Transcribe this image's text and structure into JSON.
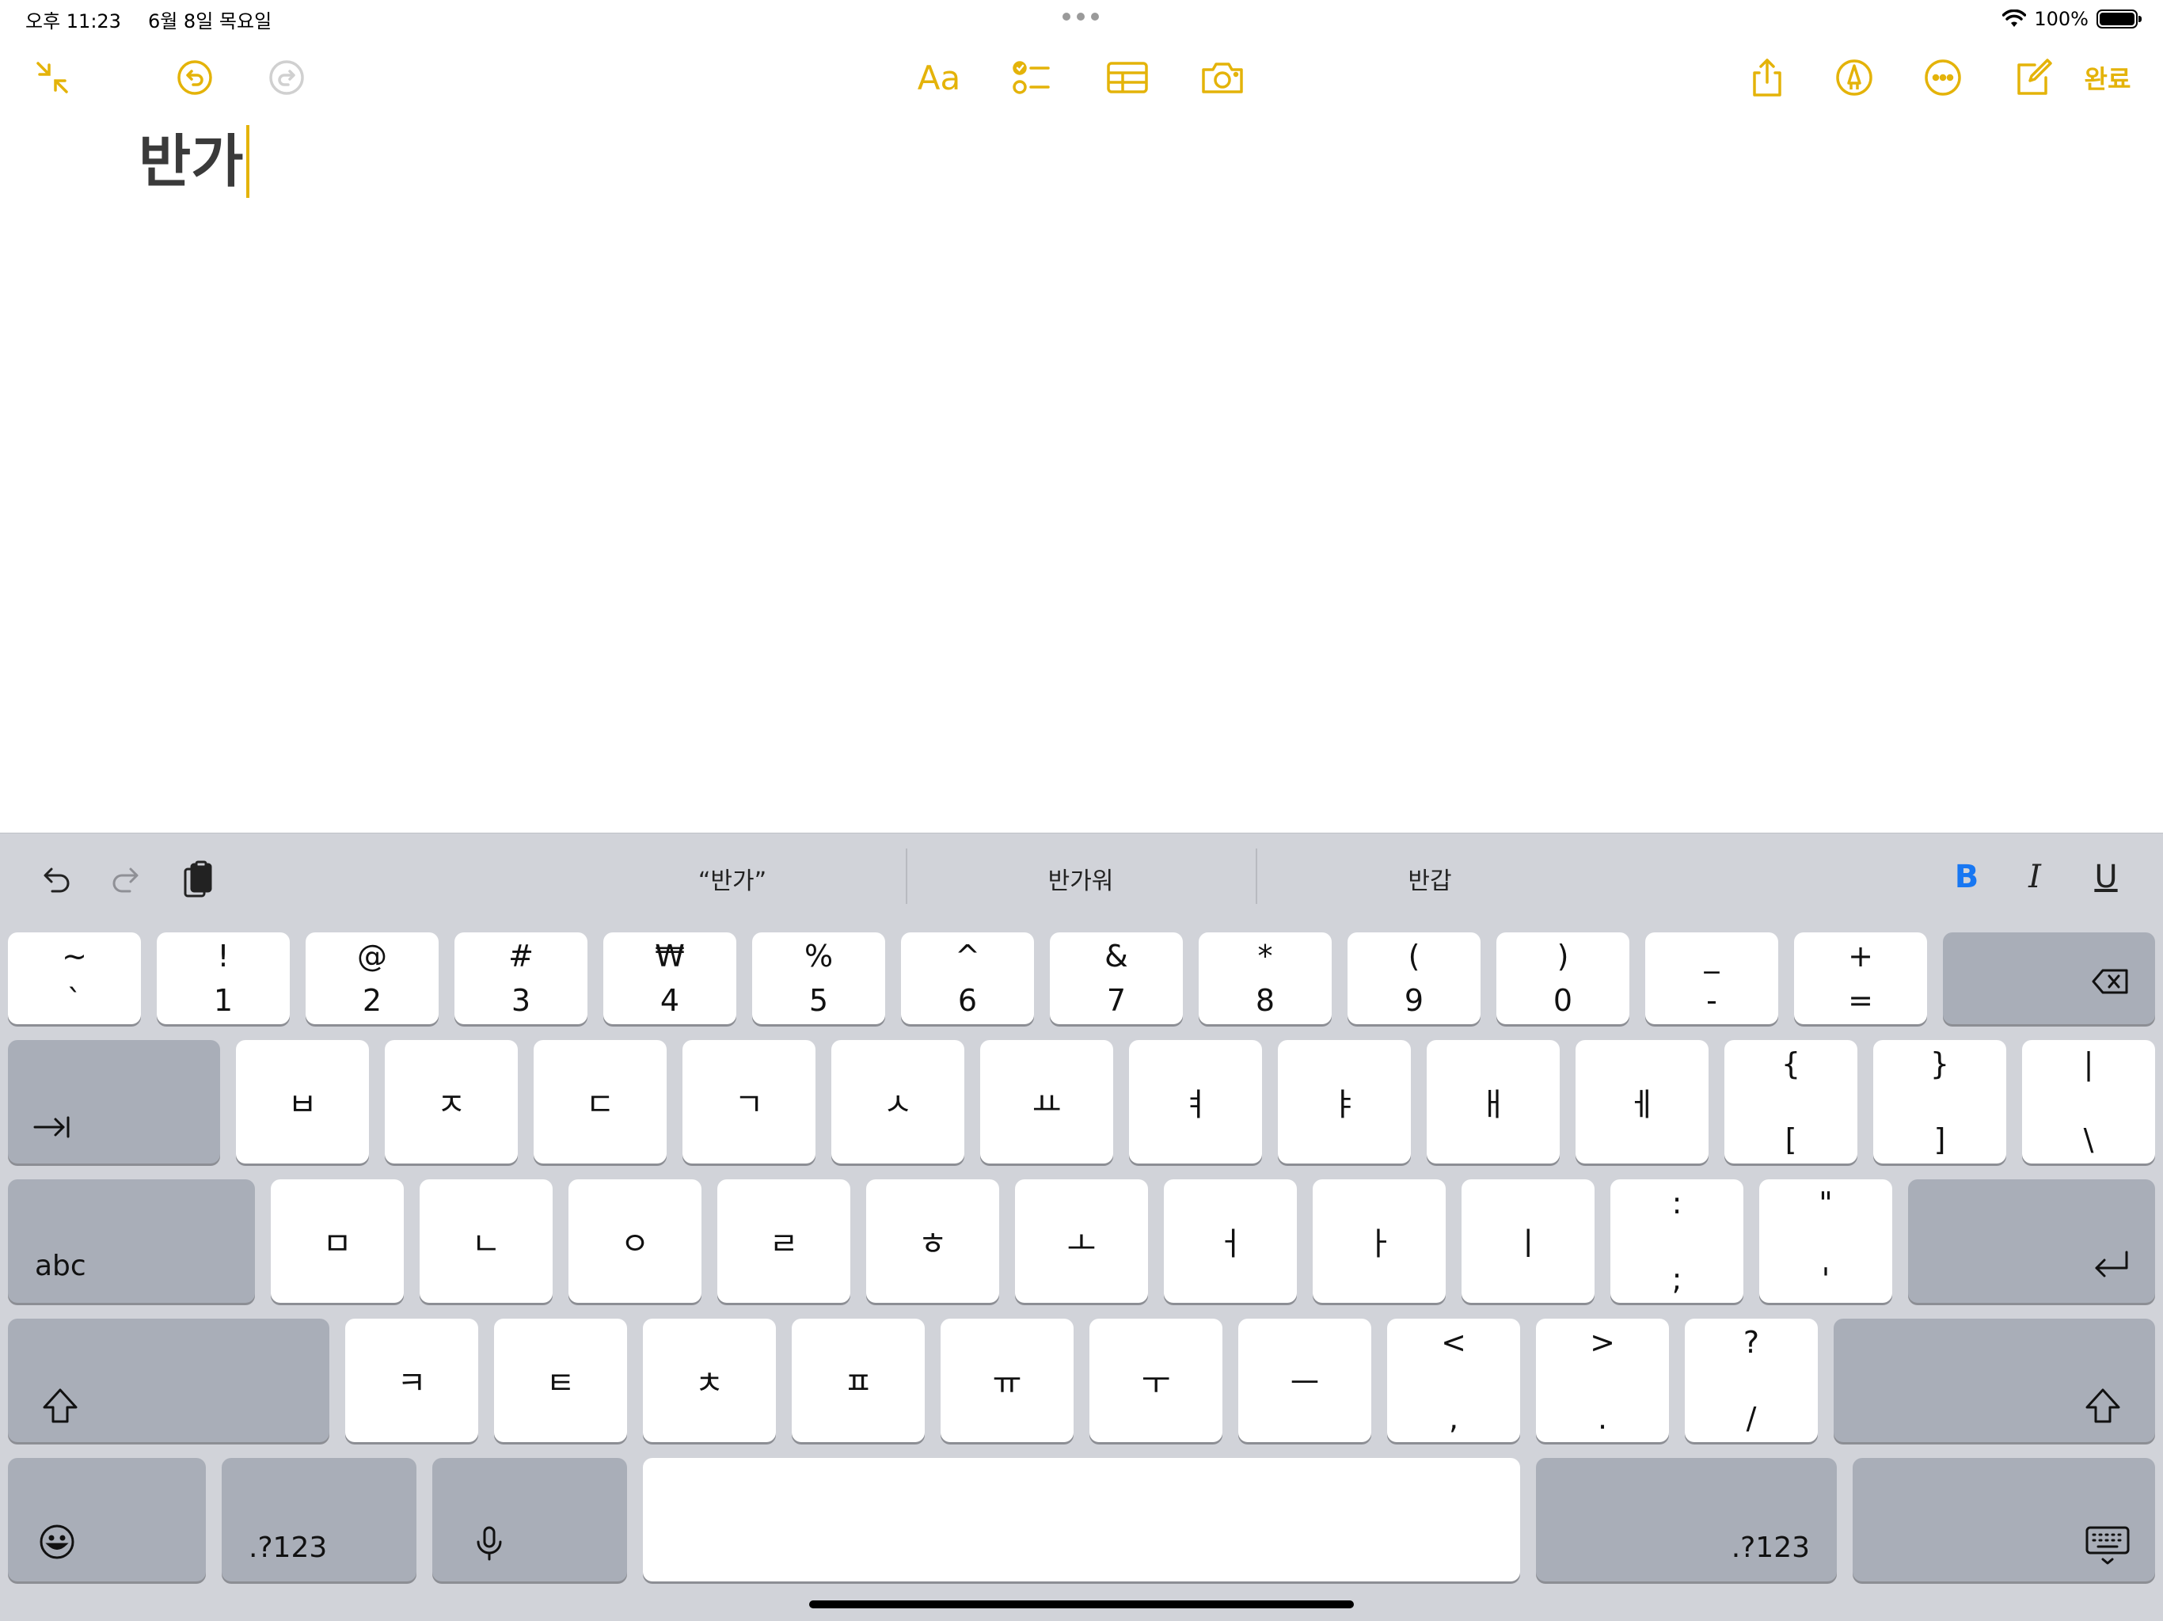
{
  "status_bar": {
    "time": "오후 11:23",
    "date": "6월 8일 목요일",
    "battery_pct": "100%",
    "battery_level": 1.0
  },
  "toolbar": {
    "format_label": "Aa",
    "done_label": "완료",
    "icons": [
      "collapse-icon",
      "undo-icon",
      "redo-icon",
      "checklist-icon",
      "table-icon",
      "camera-icon",
      "share-icon",
      "markup-icon",
      "more-icon",
      "compose-icon"
    ],
    "accent_color": "#E4B309"
  },
  "note": {
    "text": "반가"
  },
  "keyboard": {
    "suggestions": [
      "“반가”",
      "반가워",
      "반갑"
    ],
    "format": {
      "bold": "B",
      "italic": "I",
      "underline": "U"
    },
    "row1": [
      {
        "top": "~",
        "bot": "`"
      },
      {
        "top": "!",
        "bot": "1"
      },
      {
        "top": "@",
        "bot": "2"
      },
      {
        "top": "#",
        "bot": "3"
      },
      {
        "top": "₩",
        "bot": "4"
      },
      {
        "top": "%",
        "bot": "5"
      },
      {
        "top": "^",
        "bot": "6"
      },
      {
        "top": "&",
        "bot": "7"
      },
      {
        "top": "*",
        "bot": "8"
      },
      {
        "top": "(",
        "bot": "9"
      },
      {
        "top": ")",
        "bot": "0"
      },
      {
        "top": "_",
        "bot": "-"
      },
      {
        "top": "+",
        "bot": "="
      }
    ],
    "row2": [
      "ㅂ",
      "ㅈ",
      "ㄷ",
      "ㄱ",
      "ㅅ",
      "ㅛ",
      "ㅕ",
      "ㅑ",
      "ㅐ",
      "ㅔ"
    ],
    "row2_sym": [
      {
        "top": "{",
        "bot": "["
      },
      {
        "top": "}",
        "bot": "]"
      },
      {
        "top": "|",
        "bot": "\\"
      }
    ],
    "row3": [
      "ㅁ",
      "ㄴ",
      "ㅇ",
      "ㄹ",
      "ㅎ",
      "ㅗ",
      "ㅓ",
      "ㅏ",
      "ㅣ"
    ],
    "row3_sym": [
      {
        "top": ":",
        "bot": ";"
      },
      {
        "top": "\"",
        "bot": "'"
      }
    ],
    "row4": [
      "ㅋ",
      "ㅌ",
      "ㅊ",
      "ㅍ",
      "ㅠ",
      "ㅜ",
      "ㅡ"
    ],
    "row4_sym": [
      {
        "top": "<",
        "bot": ","
      },
      {
        "top": ">",
        "bot": "."
      },
      {
        "top": "?",
        "bot": "/"
      }
    ],
    "abc_label": "abc",
    "num_label_left": ".?123",
    "num_label_right": ".?123"
  }
}
